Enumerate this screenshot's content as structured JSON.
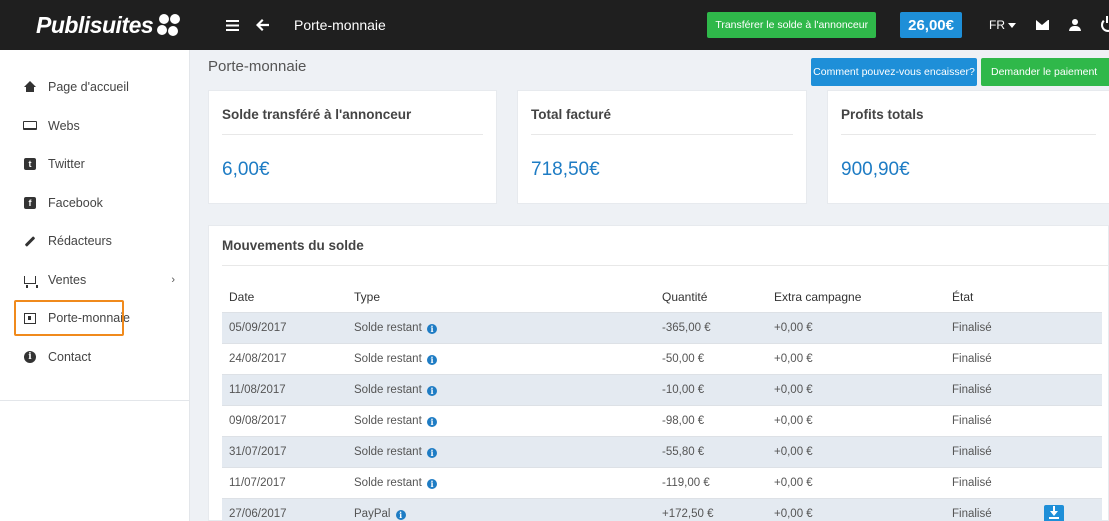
{
  "brand": {
    "logo_text": "Publisuites"
  },
  "header": {
    "title": "Porte-monnaie",
    "transfer_button": "Transférer le solde à l'annonceur",
    "balance": "26,00€",
    "language": "FR",
    "icons": [
      "menu-icon",
      "back-arrow-icon",
      "mail-icon",
      "user-icon",
      "power-icon"
    ]
  },
  "sidebar": {
    "items": [
      {
        "label": "Page d'accueil",
        "icon": "home-icon"
      },
      {
        "label": "Webs",
        "icon": "laptop-icon"
      },
      {
        "label": "Twitter",
        "icon": "twitter-icon"
      },
      {
        "label": "Facebook",
        "icon": "facebook-icon"
      },
      {
        "label": "Rédacteurs",
        "icon": "pencil-icon"
      },
      {
        "label": "Ventes",
        "icon": "cart-icon",
        "has_submenu": true
      },
      {
        "label": "Porte-monnaie",
        "icon": "wallet-icon",
        "active": true
      },
      {
        "label": "Contact",
        "icon": "info-icon"
      }
    ]
  },
  "main": {
    "page_title": "Porte-monnaie",
    "how_button": "Comment pouvez-vous encaisser?",
    "pay_button": "Demander le paiement",
    "cards": [
      {
        "title": "Solde transféré à l'annonceur",
        "value": "6,00€"
      },
      {
        "title": "Total facturé",
        "value": "718,50€"
      },
      {
        "title": "Profits totals",
        "value": "900,90€"
      }
    ],
    "movements": {
      "title": "Mouvements du solde",
      "columns": [
        "Date",
        "Type",
        "Quantité",
        "Extra campagne",
        "État"
      ],
      "rows": [
        {
          "date": "05/09/2017",
          "type": "Solde restant",
          "qty": "-365,00 €",
          "extra": "+0,00 €",
          "state": "Finalisé"
        },
        {
          "date": "24/08/2017",
          "type": "Solde restant",
          "qty": "-50,00 €",
          "extra": "+0,00 €",
          "state": "Finalisé"
        },
        {
          "date": "11/08/2017",
          "type": "Solde restant",
          "qty": "-10,00 €",
          "extra": "+0,00 €",
          "state": "Finalisé"
        },
        {
          "date": "09/08/2017",
          "type": "Solde restant",
          "qty": "-98,00 €",
          "extra": "+0,00 €",
          "state": "Finalisé"
        },
        {
          "date": "31/07/2017",
          "type": "Solde restant",
          "qty": "-55,80 €",
          "extra": "+0,00 €",
          "state": "Finalisé"
        },
        {
          "date": "11/07/2017",
          "type": "Solde restant",
          "qty": "-119,00 €",
          "extra": "+0,00 €",
          "state": "Finalisé"
        },
        {
          "date": "27/06/2017",
          "type": "PayPal",
          "qty": "+172,50 €",
          "extra": "+0,00 €",
          "state": "Finalisé",
          "download": true
        }
      ]
    }
  },
  "colors": {
    "topbar": "#1f1f1f",
    "accent_blue": "#1e8fd8",
    "accent_green": "#2fb84a",
    "highlight": "#f08a1c"
  }
}
